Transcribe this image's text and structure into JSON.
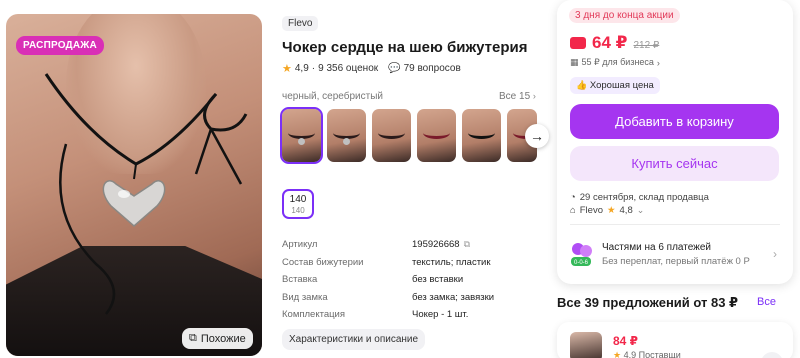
{
  "gallery": {
    "image_label": "product photo: black suede choker with silver heart pendant",
    "sale_badge": "РАСПРОДАЖА",
    "similar_button": "Похожие"
  },
  "product": {
    "brand": "Flevo",
    "title": "Чокер сердце на шею бижутерия",
    "rating": "4,9",
    "reviews": "9 356 оценок",
    "questions": "79 вопросов",
    "variant_label": "черный, серебристый",
    "variants_all": "Все 15",
    "size": {
      "value": "140",
      "sub": "140"
    }
  },
  "specs": [
    {
      "key": "Артикул",
      "value": "195926668"
    },
    {
      "key": "Состав бижутерии",
      "value": "текстиль; пластик"
    },
    {
      "key": "Вставка",
      "value": "без вставки"
    },
    {
      "key": "Вид замка",
      "value": "без замка; завязки"
    },
    {
      "key": "Комплектация",
      "value": "Чокер - 1 шт."
    }
  ],
  "characteristics_button": "Характеристики и описание",
  "buy": {
    "promo": "3 дня до конца акции",
    "price": "64 ₽",
    "old_price": "212 ₽",
    "business": "55 ₽ для бизнеса",
    "good_price": "Хорошая цена",
    "add_to_cart": "Добавить в корзину",
    "buy_now": "Купить сейчас",
    "delivery": "29 сентября, склад продавца",
    "seller": "Flevo",
    "seller_rating": "4,8",
    "split_title": "Частями на 6 платежей",
    "split_sub": "Без переплат, первый платёж 0 Р",
    "split_badge": "0-0-6"
  },
  "offers": {
    "title": "Все 39 предложений от 83 ₽",
    "all_link": "Все",
    "first_price": "84 ₽",
    "first_rating": "4,9",
    "first_seller_partial": "Поставщи"
  },
  "colors": {
    "accent_purple": "#a535f0",
    "price_red": "#f2274a",
    "sale_pink": "#d92fb6",
    "star": "#f5a623"
  }
}
